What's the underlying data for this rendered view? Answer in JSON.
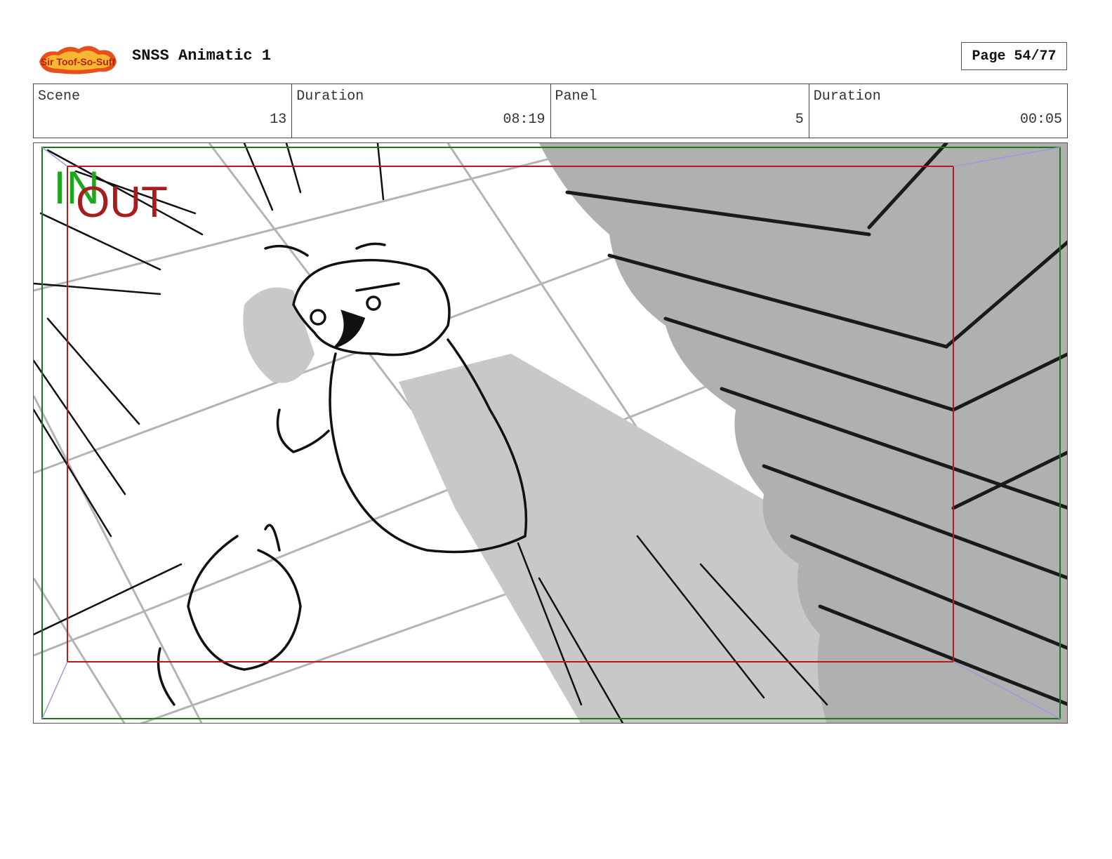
{
  "header": {
    "logo_text": "Sir Toof-So-Suff",
    "title": "SNSS Animatic 1",
    "page_label": "Page 54/77"
  },
  "info": {
    "scene_label": "Scene",
    "scene_value": "13",
    "scene_duration_label": "Duration",
    "scene_duration_value": "08:19",
    "panel_label": "Panel",
    "panel_value": "5",
    "panel_duration_label": "Duration",
    "panel_duration_value": "00:05"
  },
  "panel_frame": {
    "in_mark": "IN",
    "out_mark": "OUT",
    "colors": {
      "in_frame": "#1a7a1a",
      "out_frame": "#b01c1c",
      "shadow": "#c8c8c8",
      "wall": "#b0b0b0",
      "ink": "#111111"
    }
  }
}
